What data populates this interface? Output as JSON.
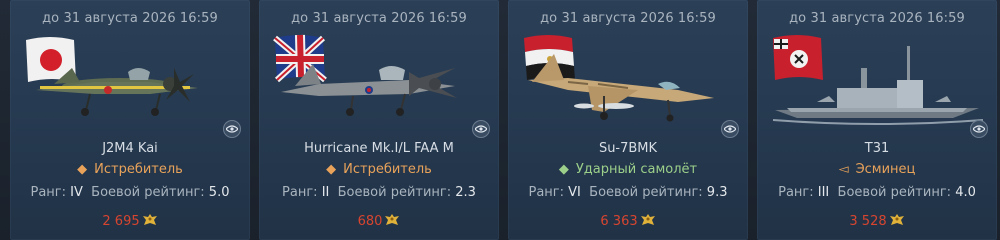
{
  "cards": [
    {
      "timer": "до 31 августа 2026 16:59",
      "name": "J2M4 Kai",
      "type_glyph": "◆",
      "type": "Истребитель",
      "type_color": "orange",
      "rank_label": "Ранг:",
      "rank": "IV",
      "br_label": "Боевой рейтинг:",
      "br": "5.0",
      "price": "2 695",
      "flag": "japan-flag",
      "vehicle_icon": "j2m4-fighter-image"
    },
    {
      "timer": "до 31 августа 2026 16:59",
      "name": "Hurricane Mk.I/L FAA M",
      "type_glyph": "◆",
      "type": "Истребитель",
      "type_color": "orange",
      "rank_label": "Ранг:",
      "rank": "II",
      "br_label": "Боевой рейтинг:",
      "br": "2.3",
      "price": "680",
      "flag": "uk-flag",
      "vehicle_icon": "hurricane-fighter-image"
    },
    {
      "timer": "до 31 августа 2026 16:59",
      "name": "Su-7BMK",
      "type_glyph": "◆",
      "type": "Ударный самолёт",
      "type_color": "green",
      "rank_label": "Ранг:",
      "rank": "VI",
      "br_label": "Боевой рейтинг:",
      "br": "9.3",
      "price": "6 363",
      "flag": "egypt-flag",
      "vehicle_icon": "su7-jet-image"
    },
    {
      "timer": "до 31 августа 2026 16:59",
      "name": "T31",
      "type_glyph": "◅",
      "type": "Эсминец",
      "type_color": "orange",
      "rank_label": "Ранг:",
      "rank": "III",
      "br_label": "Боевой рейтинг:",
      "br": "4.0",
      "price": "3 528",
      "flag": "kriegsmarine-flag",
      "vehicle_icon": "t31-destroyer-image"
    }
  ],
  "currency_icon": "golden-eagle-icon",
  "preview_icon": "eye-icon"
}
